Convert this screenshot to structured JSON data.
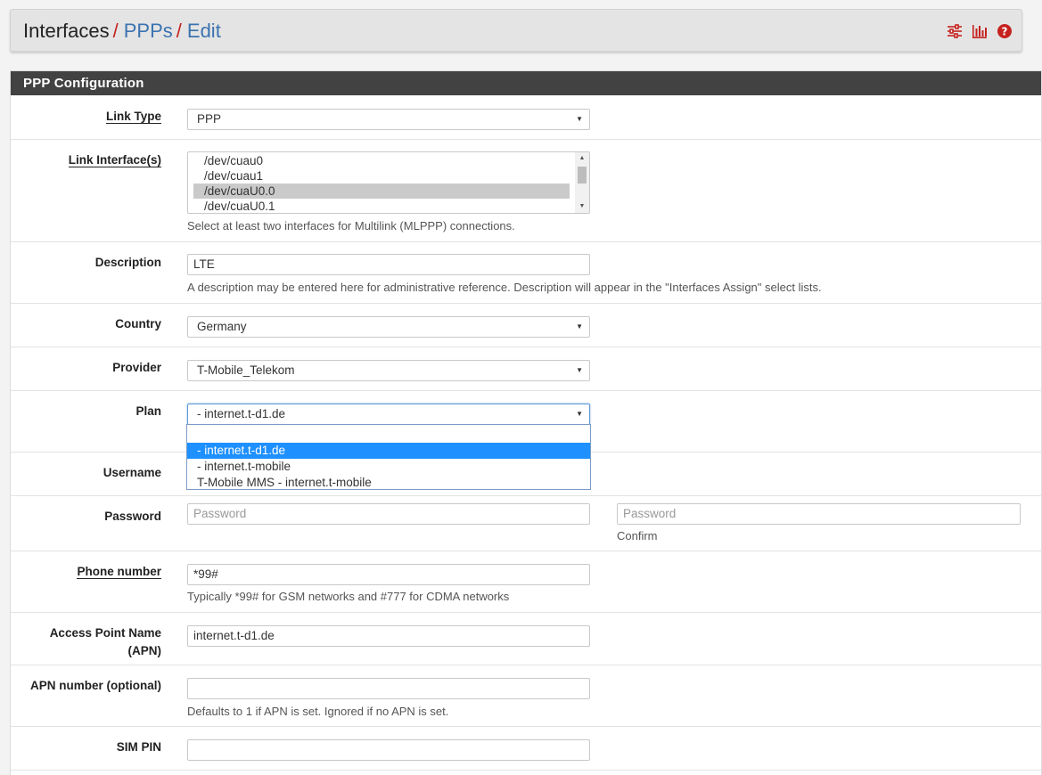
{
  "breadcrumb": {
    "root": "Interfaces",
    "sep": "/",
    "ppps": "PPPs",
    "edit": "Edit",
    "icons": [
      "sliders-icon",
      "bar-chart-icon",
      "help-icon"
    ]
  },
  "panel": {
    "title": "PPP Configuration"
  },
  "form": {
    "link_type": {
      "label": "Link Type",
      "value": "PPP"
    },
    "link_interfaces": {
      "label": "Link Interface(s)",
      "options": [
        "/dev/cuau0",
        "/dev/cuau1",
        "/dev/cuaU0.0",
        "/dev/cuaU0.1"
      ],
      "selected": "/dev/cuaU0.0",
      "help": "Select at least two interfaces for Multilink (MLPPP) connections."
    },
    "description": {
      "label": "Description",
      "value": "LTE",
      "help": "A description may be entered here for administrative reference. Description will appear in the \"Interfaces Assign\" select lists."
    },
    "country": {
      "label": "Country",
      "value": "Germany"
    },
    "provider": {
      "label": "Provider",
      "value": "T-Mobile_Telekom"
    },
    "plan": {
      "label": "Plan",
      "value": "- internet.t-d1.de",
      "options": [
        "- internet.t-d1.de",
        "- internet.t-mobile",
        "T-Mobile MMS - internet.t-mobile"
      ]
    },
    "username": {
      "label": "Username"
    },
    "password": {
      "label": "Password",
      "placeholder": "Password",
      "confirm_placeholder": "Password",
      "confirm_help": "Confirm"
    },
    "phone": {
      "label": "Phone number",
      "value": "*99#",
      "help": "Typically *99# for GSM networks and #777 for CDMA networks"
    },
    "apn": {
      "label_line1": "Access Point Name",
      "label_line2": "(APN)",
      "value": "internet.t-d1.de"
    },
    "apn_number": {
      "label": "APN number (optional)",
      "value": "",
      "help": "Defaults to 1 if APN is set. Ignored if no APN is set."
    },
    "sim_pin": {
      "label": "SIM PIN",
      "value": ""
    }
  },
  "colors": {
    "accent_red": "#c5221f",
    "link_blue": "#3b73b0",
    "header_dark": "#424242",
    "highlight": "#1e90ff"
  }
}
